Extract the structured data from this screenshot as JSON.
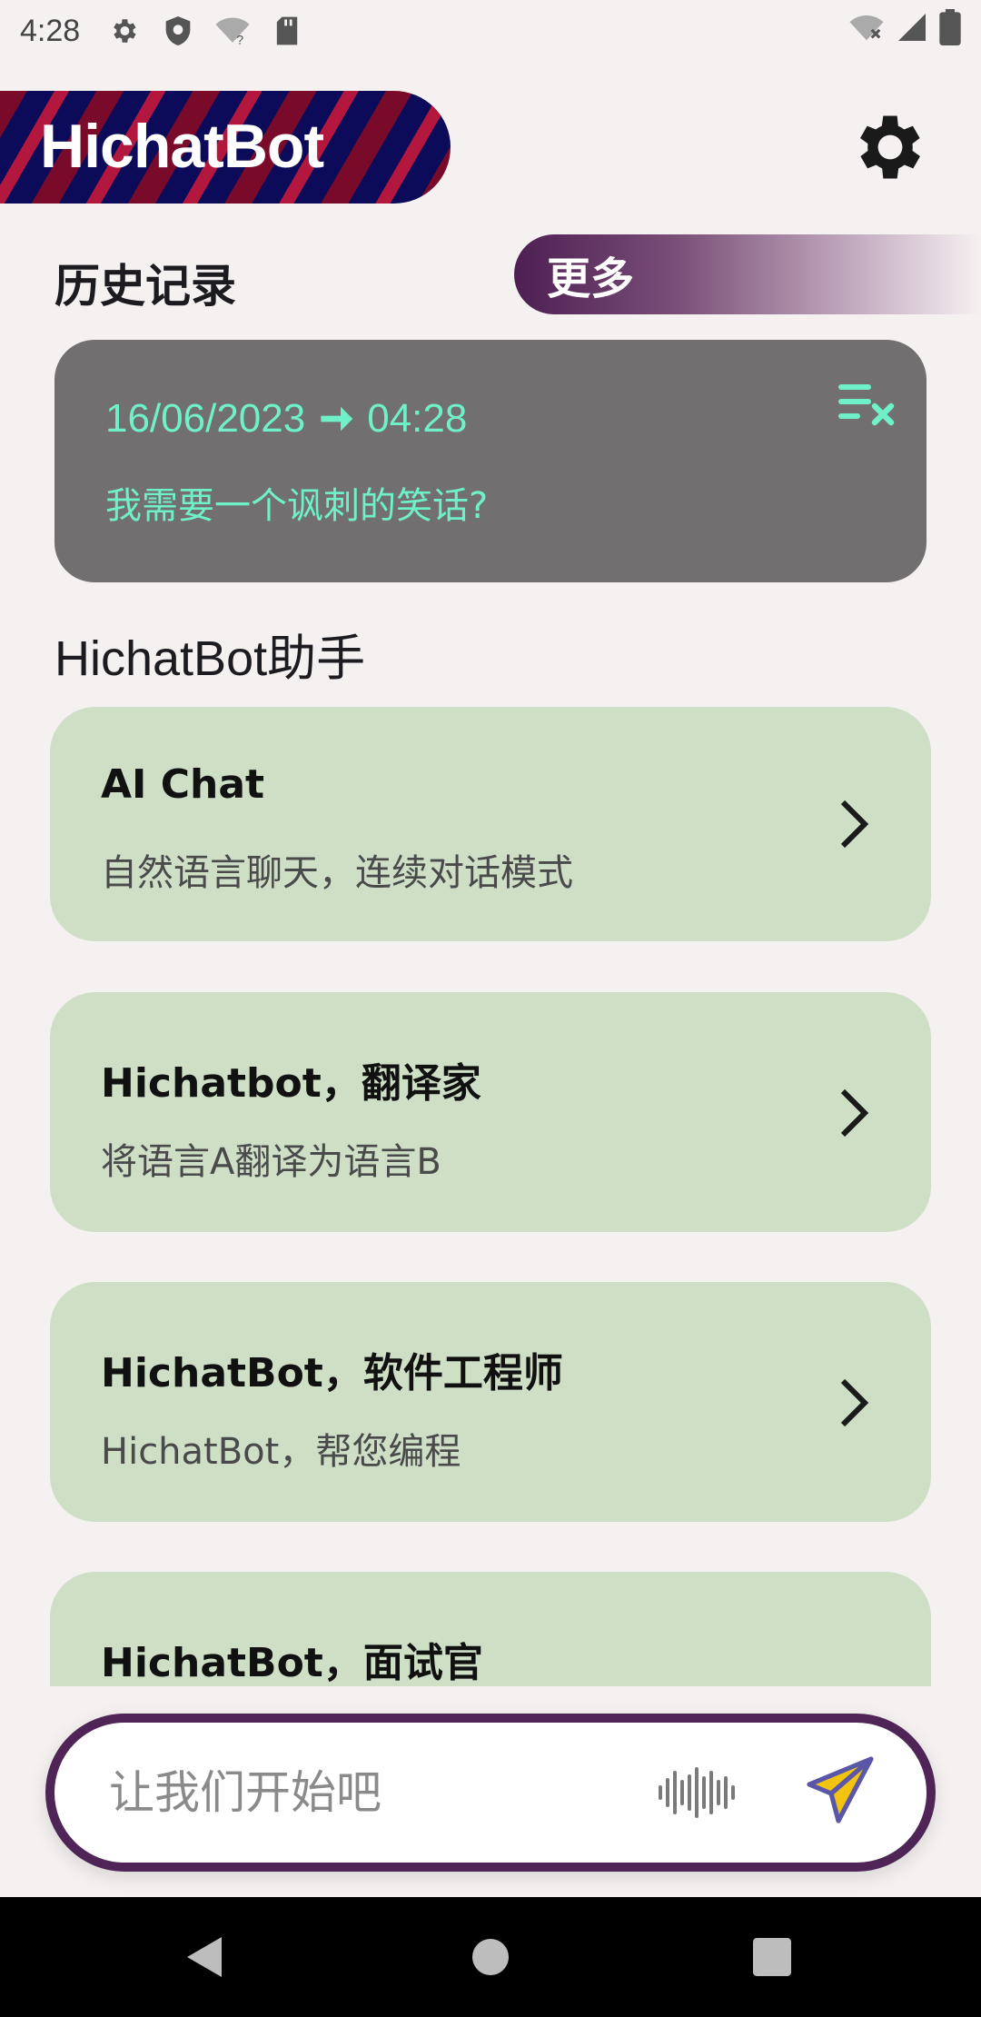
{
  "status_bar": {
    "time": "4:28"
  },
  "header": {
    "app_title": "HichatBot",
    "settings_icon": "gear-icon"
  },
  "history": {
    "title": "历史记录",
    "more_label": "更多",
    "items": [
      {
        "date": "16/06/2023",
        "time": "04:28",
        "message": "我需要一个讽刺的笑话?"
      }
    ]
  },
  "assistants": {
    "title": "HichatBot助手",
    "items": [
      {
        "name": "AI Chat",
        "description": "自然语言聊天，连续对话模式"
      },
      {
        "name": "Hichatbot，翻译家",
        "description": "将语言A翻译为语言B"
      },
      {
        "name": "HichatBot，软件工程师",
        "description": "HichatBot，帮您编程"
      },
      {
        "name": "HichatBot，面试官",
        "description": ""
      }
    ]
  },
  "input": {
    "placeholder": "让我们开始吧"
  },
  "colors": {
    "background": "#f5f1f1",
    "history_card": "#716f70",
    "history_text": "#6ff0c9",
    "assistant_card": "#cedfc6",
    "accent_purple": "#4f2558",
    "send_yellow": "#f2c30f",
    "send_outline": "#5b57a8"
  }
}
